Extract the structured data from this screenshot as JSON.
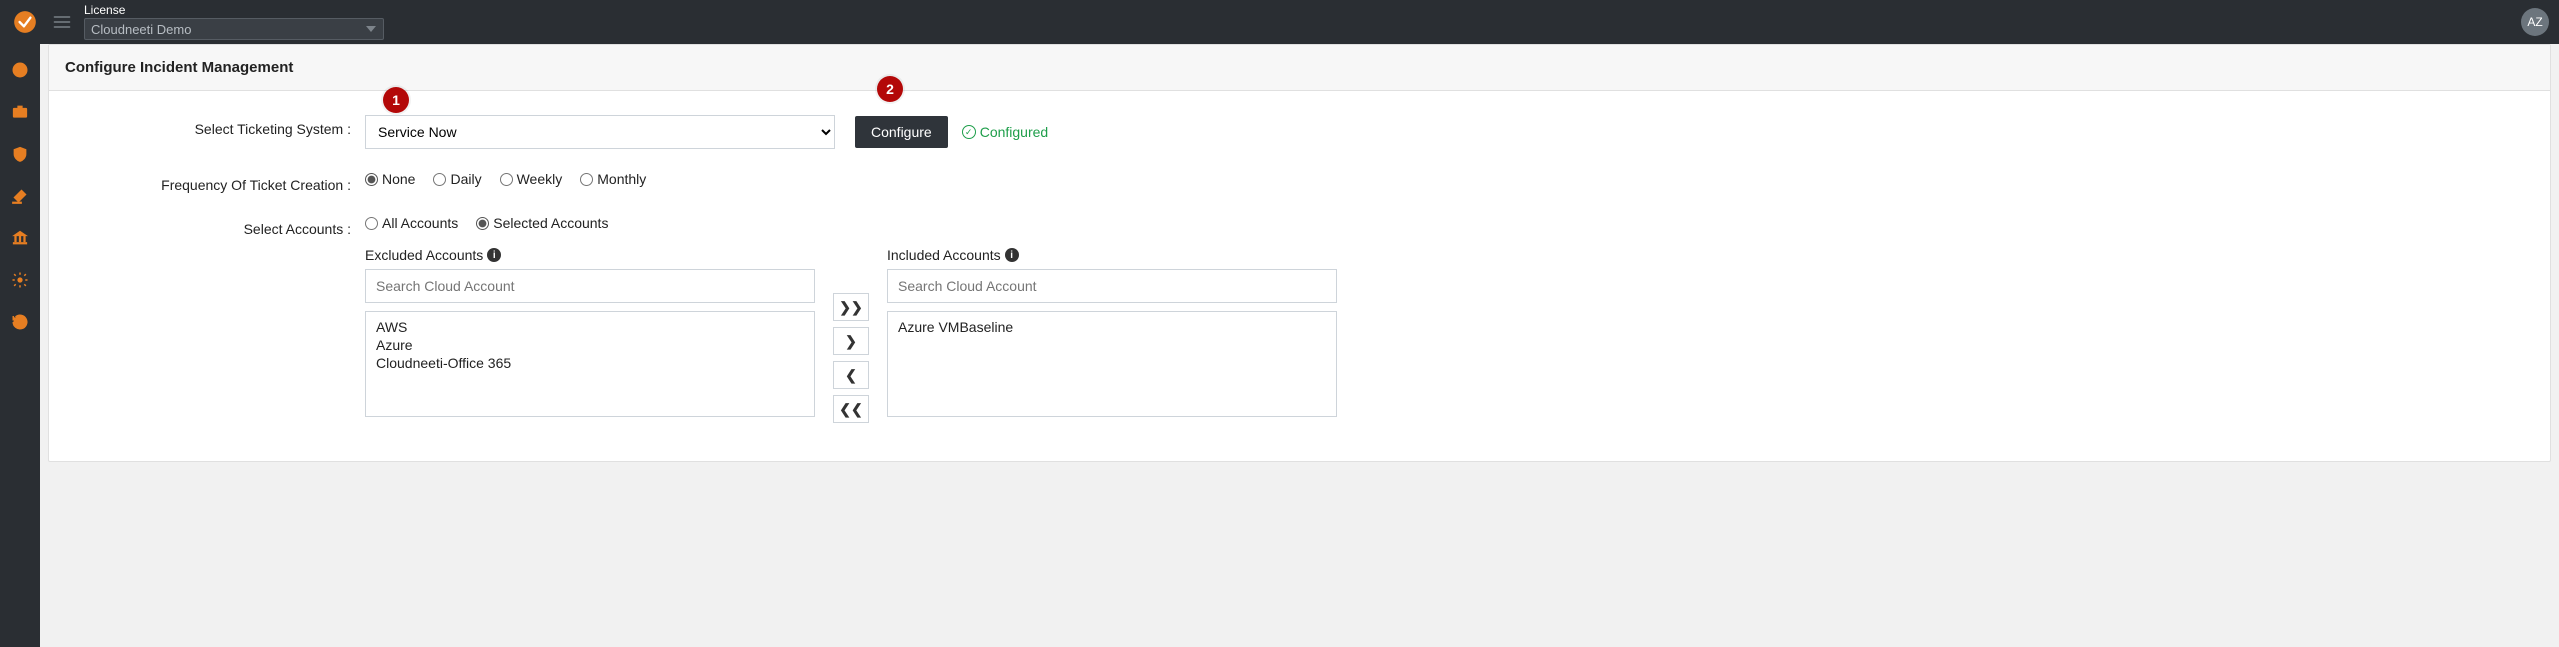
{
  "topbar": {
    "license_label": "License",
    "license_value": "Cloudneeti Demo",
    "avatar_initials": "AZ"
  },
  "page": {
    "title": "Configure Incident Management"
  },
  "steps": {
    "one": "1",
    "two": "2"
  },
  "form": {
    "ticketing_label": "Select Ticketing System :",
    "ticketing_value": "Service Now",
    "configure_button": "Configure",
    "configured_status": "Configured",
    "frequency_label": "Frequency Of Ticket Creation :",
    "frequency_options": {
      "none": "None",
      "daily": "Daily",
      "weekly": "Weekly",
      "monthly": "Monthly"
    },
    "frequency_selected": "None",
    "accounts_label": "Select Accounts :",
    "accounts_options": {
      "all": "All Accounts",
      "selected": "Selected Accounts"
    },
    "accounts_selected": "Selected Accounts"
  },
  "lists": {
    "excluded_title": "Excluded Accounts",
    "included_title": "Included Accounts",
    "search_placeholder": "Search Cloud Account",
    "excluded_items": [
      "AWS",
      "Azure",
      "Cloudneeti-Office 365"
    ],
    "included_items": [
      "Azure VMBaseline"
    ],
    "transfer": {
      "all_right": "❯❯",
      "right": "❯",
      "left": "❮",
      "all_left": "❮❮"
    }
  },
  "sidebar_icons": [
    "dashboard-icon",
    "briefcase-icon",
    "shield-icon",
    "gavel-icon",
    "bank-icon",
    "gear-icon",
    "history-icon"
  ]
}
